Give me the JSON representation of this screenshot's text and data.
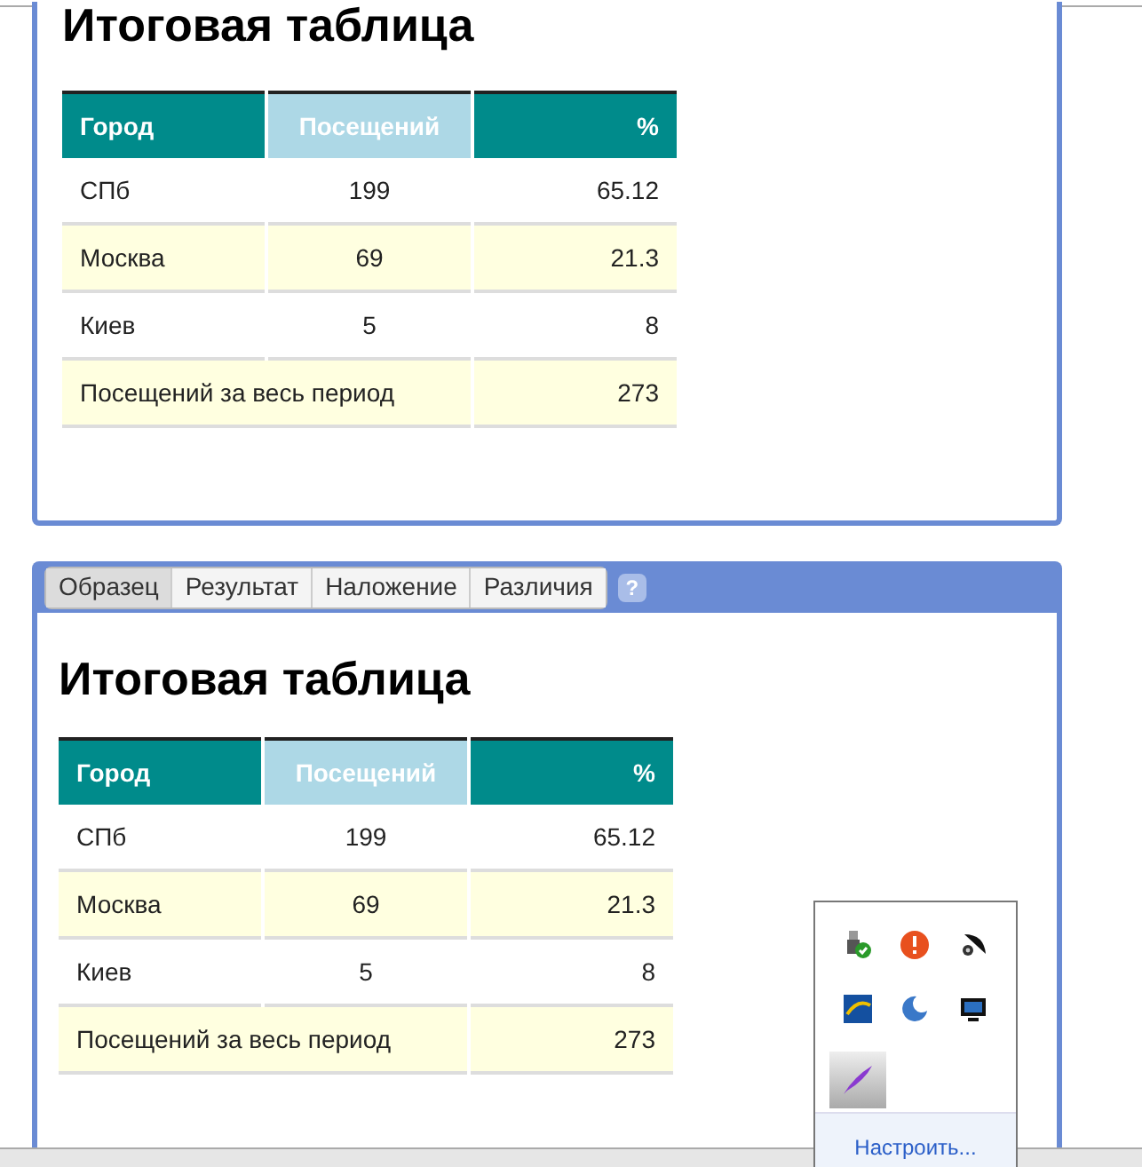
{
  "panels": [
    {
      "title": "Итоговая таблица",
      "table": {
        "columns": [
          {
            "label": "Город",
            "highlighted": false
          },
          {
            "label": "Посещений",
            "highlighted": true
          },
          {
            "label": "%",
            "highlighted": false
          }
        ],
        "rows": [
          {
            "cells": [
              {
                "text": "СПб"
              },
              {
                "text": "199"
              },
              {
                "text": "65.12"
              }
            ]
          },
          {
            "cells": [
              {
                "text": "Москва"
              },
              {
                "text": "69"
              },
              {
                "text": "21.3"
              }
            ]
          },
          {
            "cells": [
              {
                "text": "Киев"
              },
              {
                "text": "5"
              },
              {
                "text": "8"
              }
            ]
          },
          {
            "cells": [
              {
                "text": "Посещений за весь период",
                "colspan": 2
              },
              {
                "text": "273"
              }
            ]
          }
        ]
      }
    },
    {
      "tabs": [
        {
          "label": "Образец",
          "selected": true
        },
        {
          "label": "Результат",
          "selected": false
        },
        {
          "label": "Наложение",
          "selected": false
        },
        {
          "label": "Различия",
          "selected": false
        }
      ],
      "help": "?",
      "title": "Итоговая таблица",
      "table": {
        "columns": [
          {
            "label": "Город",
            "highlighted": false
          },
          {
            "label": "Посещений",
            "highlighted": true
          },
          {
            "label": "%",
            "highlighted": false
          }
        ],
        "rows": [
          {
            "cells": [
              {
                "text": "СПб"
              },
              {
                "text": "199"
              },
              {
                "text": "65.12"
              }
            ]
          },
          {
            "cells": [
              {
                "text": "Москва"
              },
              {
                "text": "69"
              },
              {
                "text": "21.3"
              }
            ]
          },
          {
            "cells": [
              {
                "text": "Киев"
              },
              {
                "text": "5"
              },
              {
                "text": "8"
              }
            ]
          },
          {
            "cells": [
              {
                "text": "Посещений за весь период",
                "colspan": 2
              },
              {
                "text": "273"
              }
            ]
          }
        ]
      }
    }
  ],
  "tray": {
    "icons": [
      {
        "kind": "usb",
        "selected": false
      },
      {
        "kind": "alert",
        "selected": false
      },
      {
        "kind": "dish",
        "selected": false
      },
      {
        "kind": "it",
        "selected": false
      },
      {
        "kind": "moon",
        "selected": false
      },
      {
        "kind": "monitor",
        "selected": false
      },
      {
        "kind": "feather",
        "selected": true
      }
    ],
    "link": "Настроить..."
  }
}
